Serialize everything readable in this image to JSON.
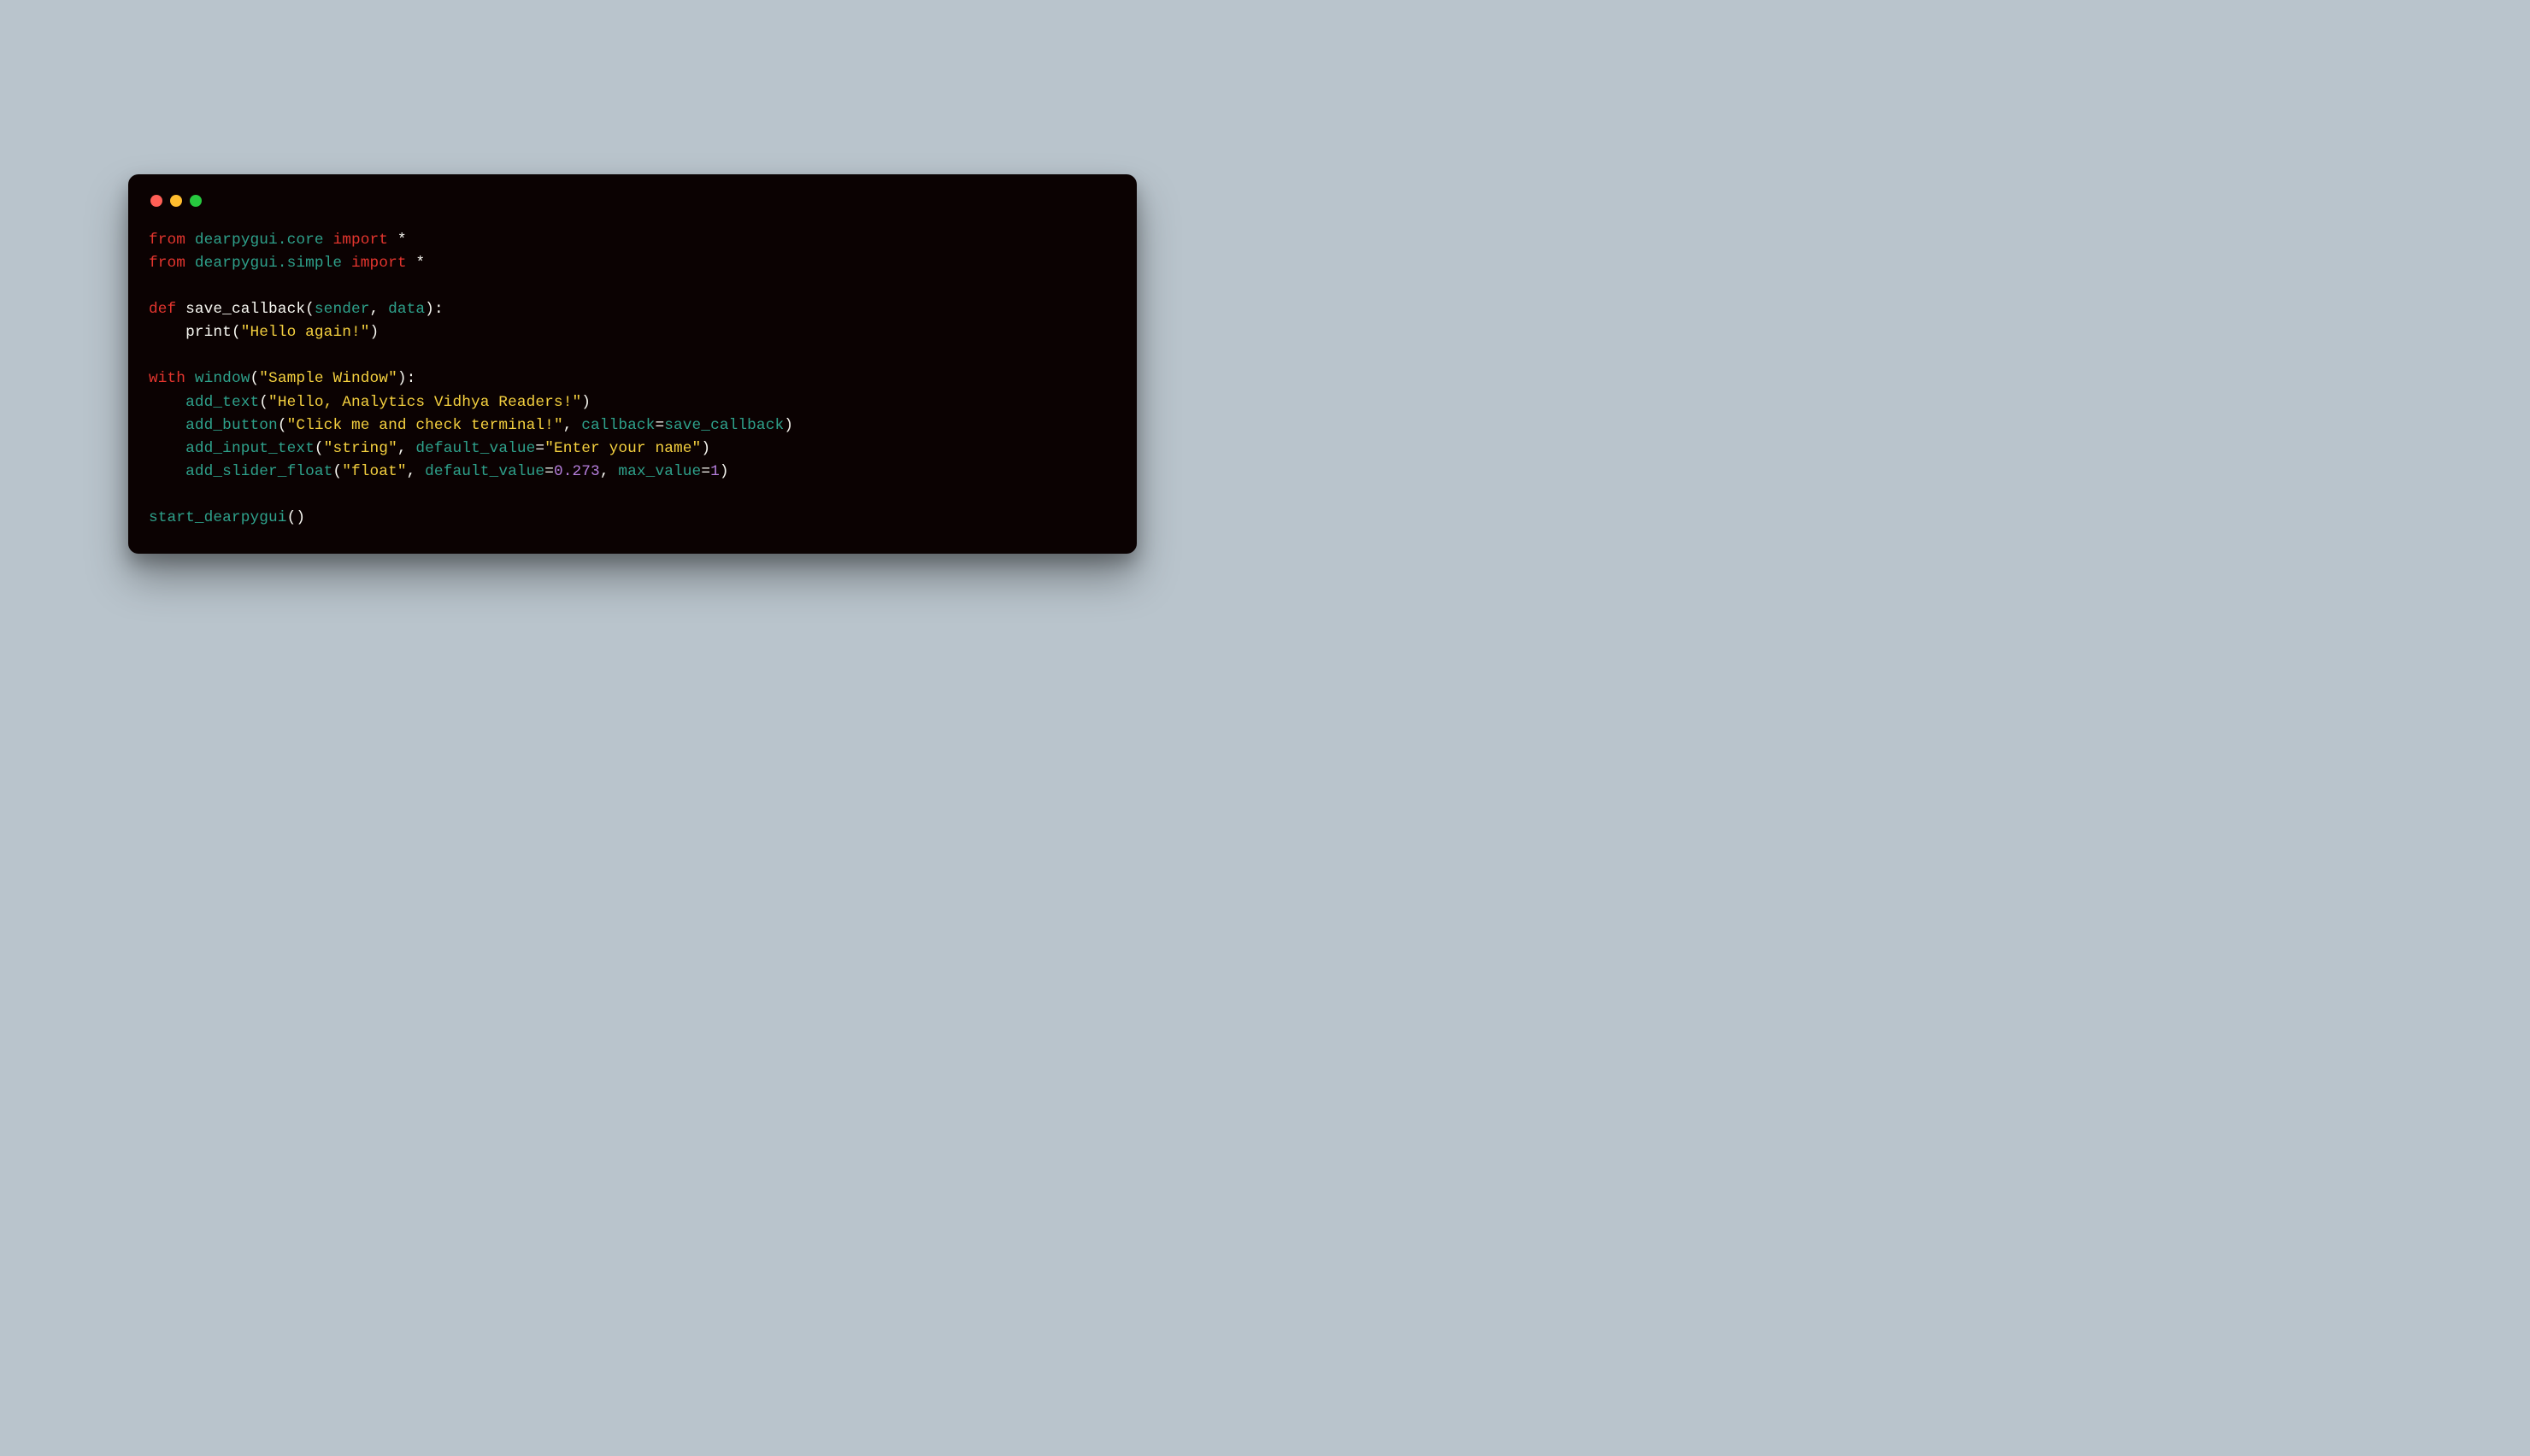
{
  "code": {
    "line1": {
      "kw1": "from",
      "mod": "dearpygui.core",
      "kw2": "import",
      "star": "*"
    },
    "line2": {
      "kw1": "from",
      "mod": "dearpygui.simple",
      "kw2": "import",
      "star": "*"
    },
    "line4": {
      "kw": "def",
      "fn": "save_callback",
      "lp": "(",
      "p1": "sender",
      "comma": ", ",
      "p2": "data",
      "rp": ")",
      "colon": ":"
    },
    "line5": {
      "indent": "    ",
      "fn": "print",
      "lp": "(",
      "str": "\"Hello again!\"",
      "rp": ")"
    },
    "line7": {
      "kw": "with",
      "fn": "window",
      "lp": "(",
      "str": "\"Sample Window\"",
      "rp": ")",
      "colon": ":"
    },
    "line8": {
      "indent": "    ",
      "fn": "add_text",
      "lp": "(",
      "str": "\"Hello, Analytics Vidhya Readers!\"",
      "rp": ")"
    },
    "line9": {
      "indent": "    ",
      "fn": "add_button",
      "lp": "(",
      "str": "\"Click me and check terminal!\"",
      "comma": ", ",
      "kwarg": "callback",
      "eq": "=",
      "val": "save_callback",
      "rp": ")"
    },
    "line10": {
      "indent": "    ",
      "fn": "add_input_text",
      "lp": "(",
      "str": "\"string\"",
      "comma": ", ",
      "kwarg": "default_value",
      "eq": "=",
      "val": "\"Enter your name\"",
      "rp": ")"
    },
    "line11": {
      "indent": "    ",
      "fn": "add_slider_float",
      "lp": "(",
      "str": "\"float\"",
      "comma1": ", ",
      "kwarg1": "default_value",
      "eq1": "=",
      "val1": "0.273",
      "comma2": ", ",
      "kwarg2": "max_value",
      "eq2": "=",
      "val2": "1",
      "rp": ")"
    },
    "line13": {
      "fn": "start_dearpygui",
      "lp": "(",
      "rp": ")"
    }
  }
}
